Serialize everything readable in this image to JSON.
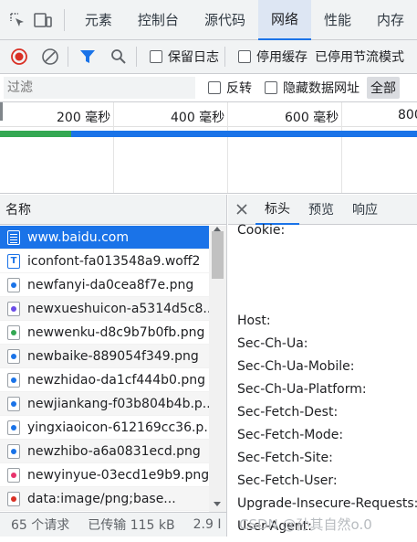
{
  "top_tabs": [
    "元素",
    "控制台",
    "源代码",
    "网络",
    "性能",
    "内存"
  ],
  "active_top_tab": "网络",
  "toolbar": {
    "preserve_log": "保留日志",
    "disable_cache": "停用缓存",
    "throttling": "已停用节流模式"
  },
  "filter": {
    "placeholder": "过滤",
    "invert": "反转",
    "hide_data_urls": "隐藏数据网址",
    "all": "全部"
  },
  "timeline": {
    "ticks": [
      "200 毫秒",
      "400 毫秒",
      "600 毫秒",
      "800"
    ]
  },
  "list_header": "名称",
  "requests": [
    {
      "name": "www.baidu.com",
      "icon": "document-icon"
    },
    {
      "name": "iconfont-fa013548a9.woff2",
      "icon": "font-icon"
    },
    {
      "name": "newfanyi-da0cea8f7e.png",
      "icon": "image-icon"
    },
    {
      "name": "newxueshuicon-a5314d5c8...",
      "icon": "image-icon"
    },
    {
      "name": "newwenku-d8c9b7b0fb.png",
      "icon": "image-icon"
    },
    {
      "name": "newbaike-889054f349.png",
      "icon": "image-icon"
    },
    {
      "name": "newzhidao-da1cf444b0.png",
      "icon": "image-icon"
    },
    {
      "name": "newjiankang-f03b804b4b.p...",
      "icon": "image-icon"
    },
    {
      "name": "yingxiaoicon-612169cc36.p...",
      "icon": "image-icon"
    },
    {
      "name": "newzhibo-a6a0831ecd.png",
      "icon": "image-icon"
    },
    {
      "name": "newyinyue-03ecd1e9b9.png",
      "icon": "image-icon"
    },
    {
      "name": "data:image/png;base...",
      "icon": "image-icon"
    }
  ],
  "detail_tabs": [
    "标头",
    "预览",
    "响应"
  ],
  "headers": [
    "Cookie:",
    "Host:",
    "Sec-Ch-Ua:",
    "Sec-Ch-Ua-Mobile:",
    "Sec-Ch-Ua-Platform:",
    "Sec-Fetch-Dest:",
    "Sec-Fetch-Mode:",
    "Sec-Fetch-Site:",
    "Sec-Fetch-User:",
    "Upgrade-Insecure-Requests:",
    "User-Agent:"
  ],
  "status": {
    "requests": "65 个请求",
    "transferred": "已传输 115 kB",
    "resources": "2.9 I"
  },
  "watermark": "CSDN @孙其自然o.0",
  "colors": {
    "accent": "#1a73e8",
    "record": "#d93025",
    "timeline_green": "#34a853"
  }
}
